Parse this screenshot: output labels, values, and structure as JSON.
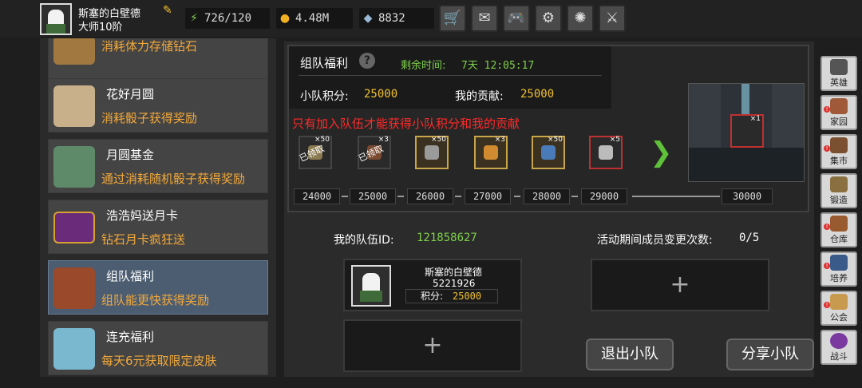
{
  "player": {
    "name": "斯塞的白壁德",
    "level": "大师10阶"
  },
  "resources": {
    "stamina": "726/120",
    "gold": "4.48M",
    "diamond": "8832"
  },
  "top_buttons": [
    "shop-cart-icon",
    "mail-icon",
    "gamepad-icon",
    "settings-icon",
    "gacha-icon",
    "sword-icon"
  ],
  "events": [
    {
      "title": "",
      "desc": "消耗体力存储钻石"
    },
    {
      "title": "花好月圆",
      "desc": "消耗骰子获得奖励"
    },
    {
      "title": "月圆基金",
      "desc": "通过消耗随机骰子获得奖励"
    },
    {
      "title": "浩浩妈送月卡",
      "desc": "钻石月卡疯狂送"
    },
    {
      "title": "组队福利",
      "desc": "组队能更快获得奖励"
    },
    {
      "title": "连充福利",
      "desc": "每天6元获取限定皮肤"
    }
  ],
  "panel": {
    "title": "组队福利",
    "time_label": "剩余时间:",
    "time_value": "7天 12:05:17",
    "team_points_label": "小队积分:",
    "team_points_value": "25000",
    "my_contrib_label": "我的贡献:",
    "my_contrib_value": "25000",
    "warning": "只有加入队伍才能获得小队积分和我的贡献"
  },
  "rewards": [
    {
      "count": "×50",
      "stamp": "已领取"
    },
    {
      "count": "×3",
      "stamp": "已领取"
    },
    {
      "count": "×50",
      "stamp": ""
    },
    {
      "count": "×3",
      "stamp": ""
    },
    {
      "count": "×50",
      "stamp": ""
    },
    {
      "count": "×5",
      "stamp": ""
    }
  ],
  "thresholds": [
    "24000",
    "25000",
    "26000",
    "27000",
    "28000",
    "29000",
    "30000"
  ],
  "final_reward_count": "×1",
  "team": {
    "id_label": "我的队伍ID:",
    "id_value": "121858627",
    "changes_label": "活动期间成员变更次数:",
    "changes_value": "0/5",
    "member": {
      "name": "斯塞的白壁德",
      "id": "5221926",
      "score_label": "积分:",
      "score_value": "25000"
    },
    "leave_label": "退出小队",
    "share_label": "分享小队"
  },
  "nav": [
    {
      "label": "英雄",
      "badge": false
    },
    {
      "label": "家园",
      "badge": true
    },
    {
      "label": "集市",
      "badge": true
    },
    {
      "label": "锻造",
      "badge": false
    },
    {
      "label": "仓库",
      "badge": true
    },
    {
      "label": "培养",
      "badge": true
    },
    {
      "label": "公会",
      "badge": true
    },
    {
      "label": "战斗",
      "badge": false
    }
  ],
  "colors": {
    "accent_orange": "#f2a93b",
    "accent_green": "#7fd04b",
    "accent_gold": "#f0c030",
    "warning_red": "#ff2a2a",
    "active_item": "#4c5d72"
  }
}
